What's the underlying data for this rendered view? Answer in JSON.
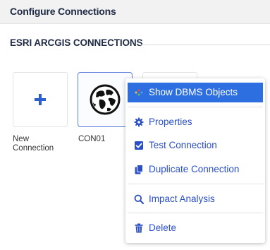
{
  "header": {
    "title": "Configure Connections"
  },
  "section": {
    "title": "ESRI ARCGIS CONNECTIONS"
  },
  "tiles": [
    {
      "label": "New Connection",
      "icon": "plus-icon"
    },
    {
      "label": "CON01",
      "icon": "globe-icon"
    }
  ],
  "context_menu": {
    "items": [
      {
        "label": "Show DBMS Objects",
        "icon": "database-objects-icon"
      },
      {
        "label": "Properties",
        "icon": "gear-icon"
      },
      {
        "label": "Test Connection",
        "icon": "checkbox-icon"
      },
      {
        "label": "Duplicate Connection",
        "icon": "copy-icon"
      },
      {
        "label": "Impact Analysis",
        "icon": "search-icon"
      },
      {
        "label": "Delete",
        "icon": "trash-icon"
      }
    ]
  },
  "colors": {
    "accent": "#2d6fe0",
    "menu_text": "#2b4fc4",
    "plus": "#2b5fd0",
    "header_bg": "#f2f2f2",
    "title_text": "#1f2a44"
  }
}
